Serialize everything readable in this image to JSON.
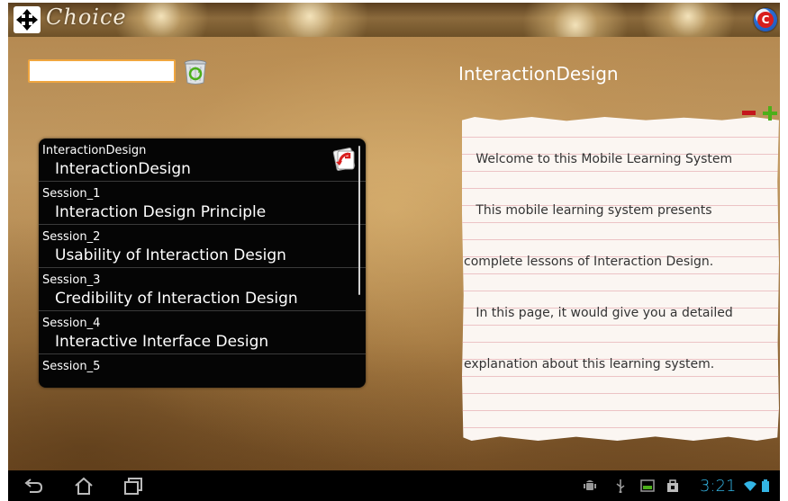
{
  "app": {
    "title": "Choice"
  },
  "search": {
    "value": "",
    "placeholder": ""
  },
  "content": {
    "heading": "InteractionDesign"
  },
  "list": {
    "items": [
      {
        "sub": "InteractionDesign",
        "main": "InteractionDesign"
      },
      {
        "sub": "Session_1",
        "main": "Interaction Design Principle"
      },
      {
        "sub": "Session_2",
        "main": "Usability of Interaction Design"
      },
      {
        "sub": "Session_3",
        "main": "Credibility of Interaction Design"
      },
      {
        "sub": "Session_4",
        "main": "Interactive Interface Design"
      },
      {
        "sub": "Session_5",
        "main": ""
      }
    ]
  },
  "note": {
    "lines": [
      "   Welcome to this Mobile Learning System",
      "   This mobile learning system presents",
      "complete lessons of Interaction Design.",
      "   In this page, it would give you a detailed",
      "explanation about this learning system."
    ]
  },
  "statusbar": {
    "time": "3:21"
  },
  "colors": {
    "accent_orange": "#f0a640",
    "list_background": "#050505",
    "note_line": "#ecc3c5",
    "clock_blue": "#33b5e5",
    "minus_red": "#c4161c",
    "plus_green": "#4caf1a"
  },
  "icons": {
    "move": "move-arrows-icon",
    "logo": "app-logo-icon",
    "trash": "recycle-bin-icon",
    "share": "share-icon",
    "minus": "minus-icon",
    "plus": "plus-icon",
    "back": "back-icon",
    "home": "home-icon",
    "recent": "recent-apps-icon",
    "android": "android-debug-icon",
    "usb": "usb-icon",
    "gallery": "screenshot-icon",
    "bag": "bag-icon",
    "wifi": "wifi-icon",
    "battery": "battery-icon"
  }
}
